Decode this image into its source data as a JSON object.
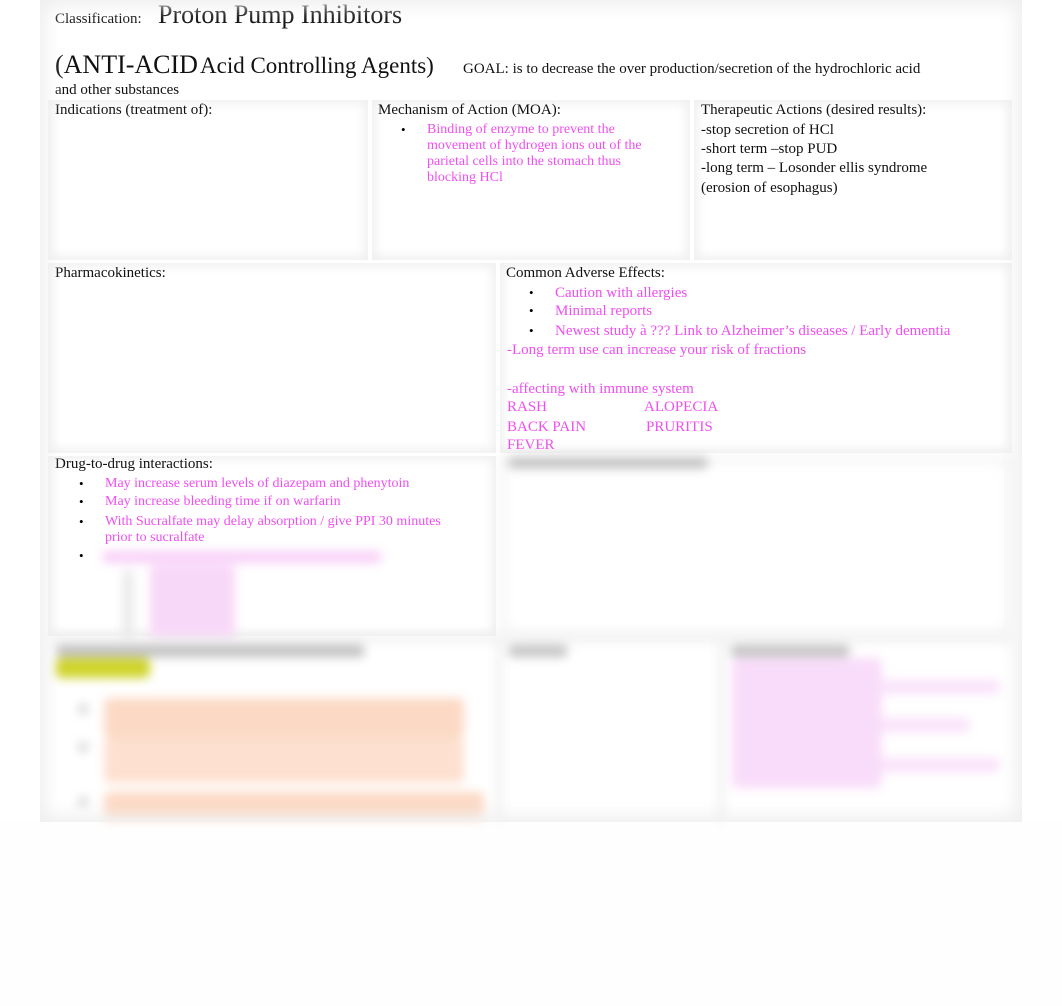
{
  "header": {
    "classification_label": "Classification:",
    "classification_value": "Proton Pump Inhibitors",
    "anti_acid": "(ANTI-ACID",
    "acid_controlling": "Acid Controlling Agents)",
    "goal_line1": "GOAL: is to decrease the over production/secretion of the hydrochloric acid",
    "goal_line2": "and other substances"
  },
  "indications": {
    "title": "Indications (treatment of):"
  },
  "moa": {
    "title": "Mechanism of Action (MOA):",
    "bullets": [
      "Binding of enzyme to prevent the movement of hydrogen ions out of the parietal cells into the stomach thus blocking HCl"
    ]
  },
  "therapeutic": {
    "title": "Therapeutic Actions (desired results):",
    "lines": [
      "-stop secretion of HCl",
      "-short term –stop PUD",
      "-long term – Losonder ellis syndrome",
      "(erosion of esophagus)"
    ]
  },
  "pharmacokinetics": {
    "title": "Pharmacokinetics:"
  },
  "adverse": {
    "title": "Common Adverse Effects:",
    "bullets": [
      "Caution with allergies",
      "Minimal reports",
      "Newest study  à ??? Link to Alzheimer’s diseases / Early dementia"
    ],
    "lines": [
      "-Long term use can increase your risk of fractions",
      "-affecting with immune system"
    ],
    "grid": [
      [
        "RASH",
        "ALOPECIA"
      ],
      [
        "BACK PAIN",
        "PRURITIS"
      ],
      [
        "FEVER",
        ""
      ]
    ]
  },
  "interactions": {
    "title": "Drug-to-drug interactions:",
    "bullets": [
      "May increase serum levels of diazepam and phenytoin",
      "May increase bleeding time if on warfarin",
      "With Sucralfate may delay absorption / give PPI 30 minutes prior to sucralfate"
    ]
  },
  "colors": {
    "accent_pink": "#f04ef0",
    "highlight_yellow": "#cfd42a",
    "blurred_orange": "#fcd9c4",
    "blurred_pink": "#f8d8f8"
  }
}
